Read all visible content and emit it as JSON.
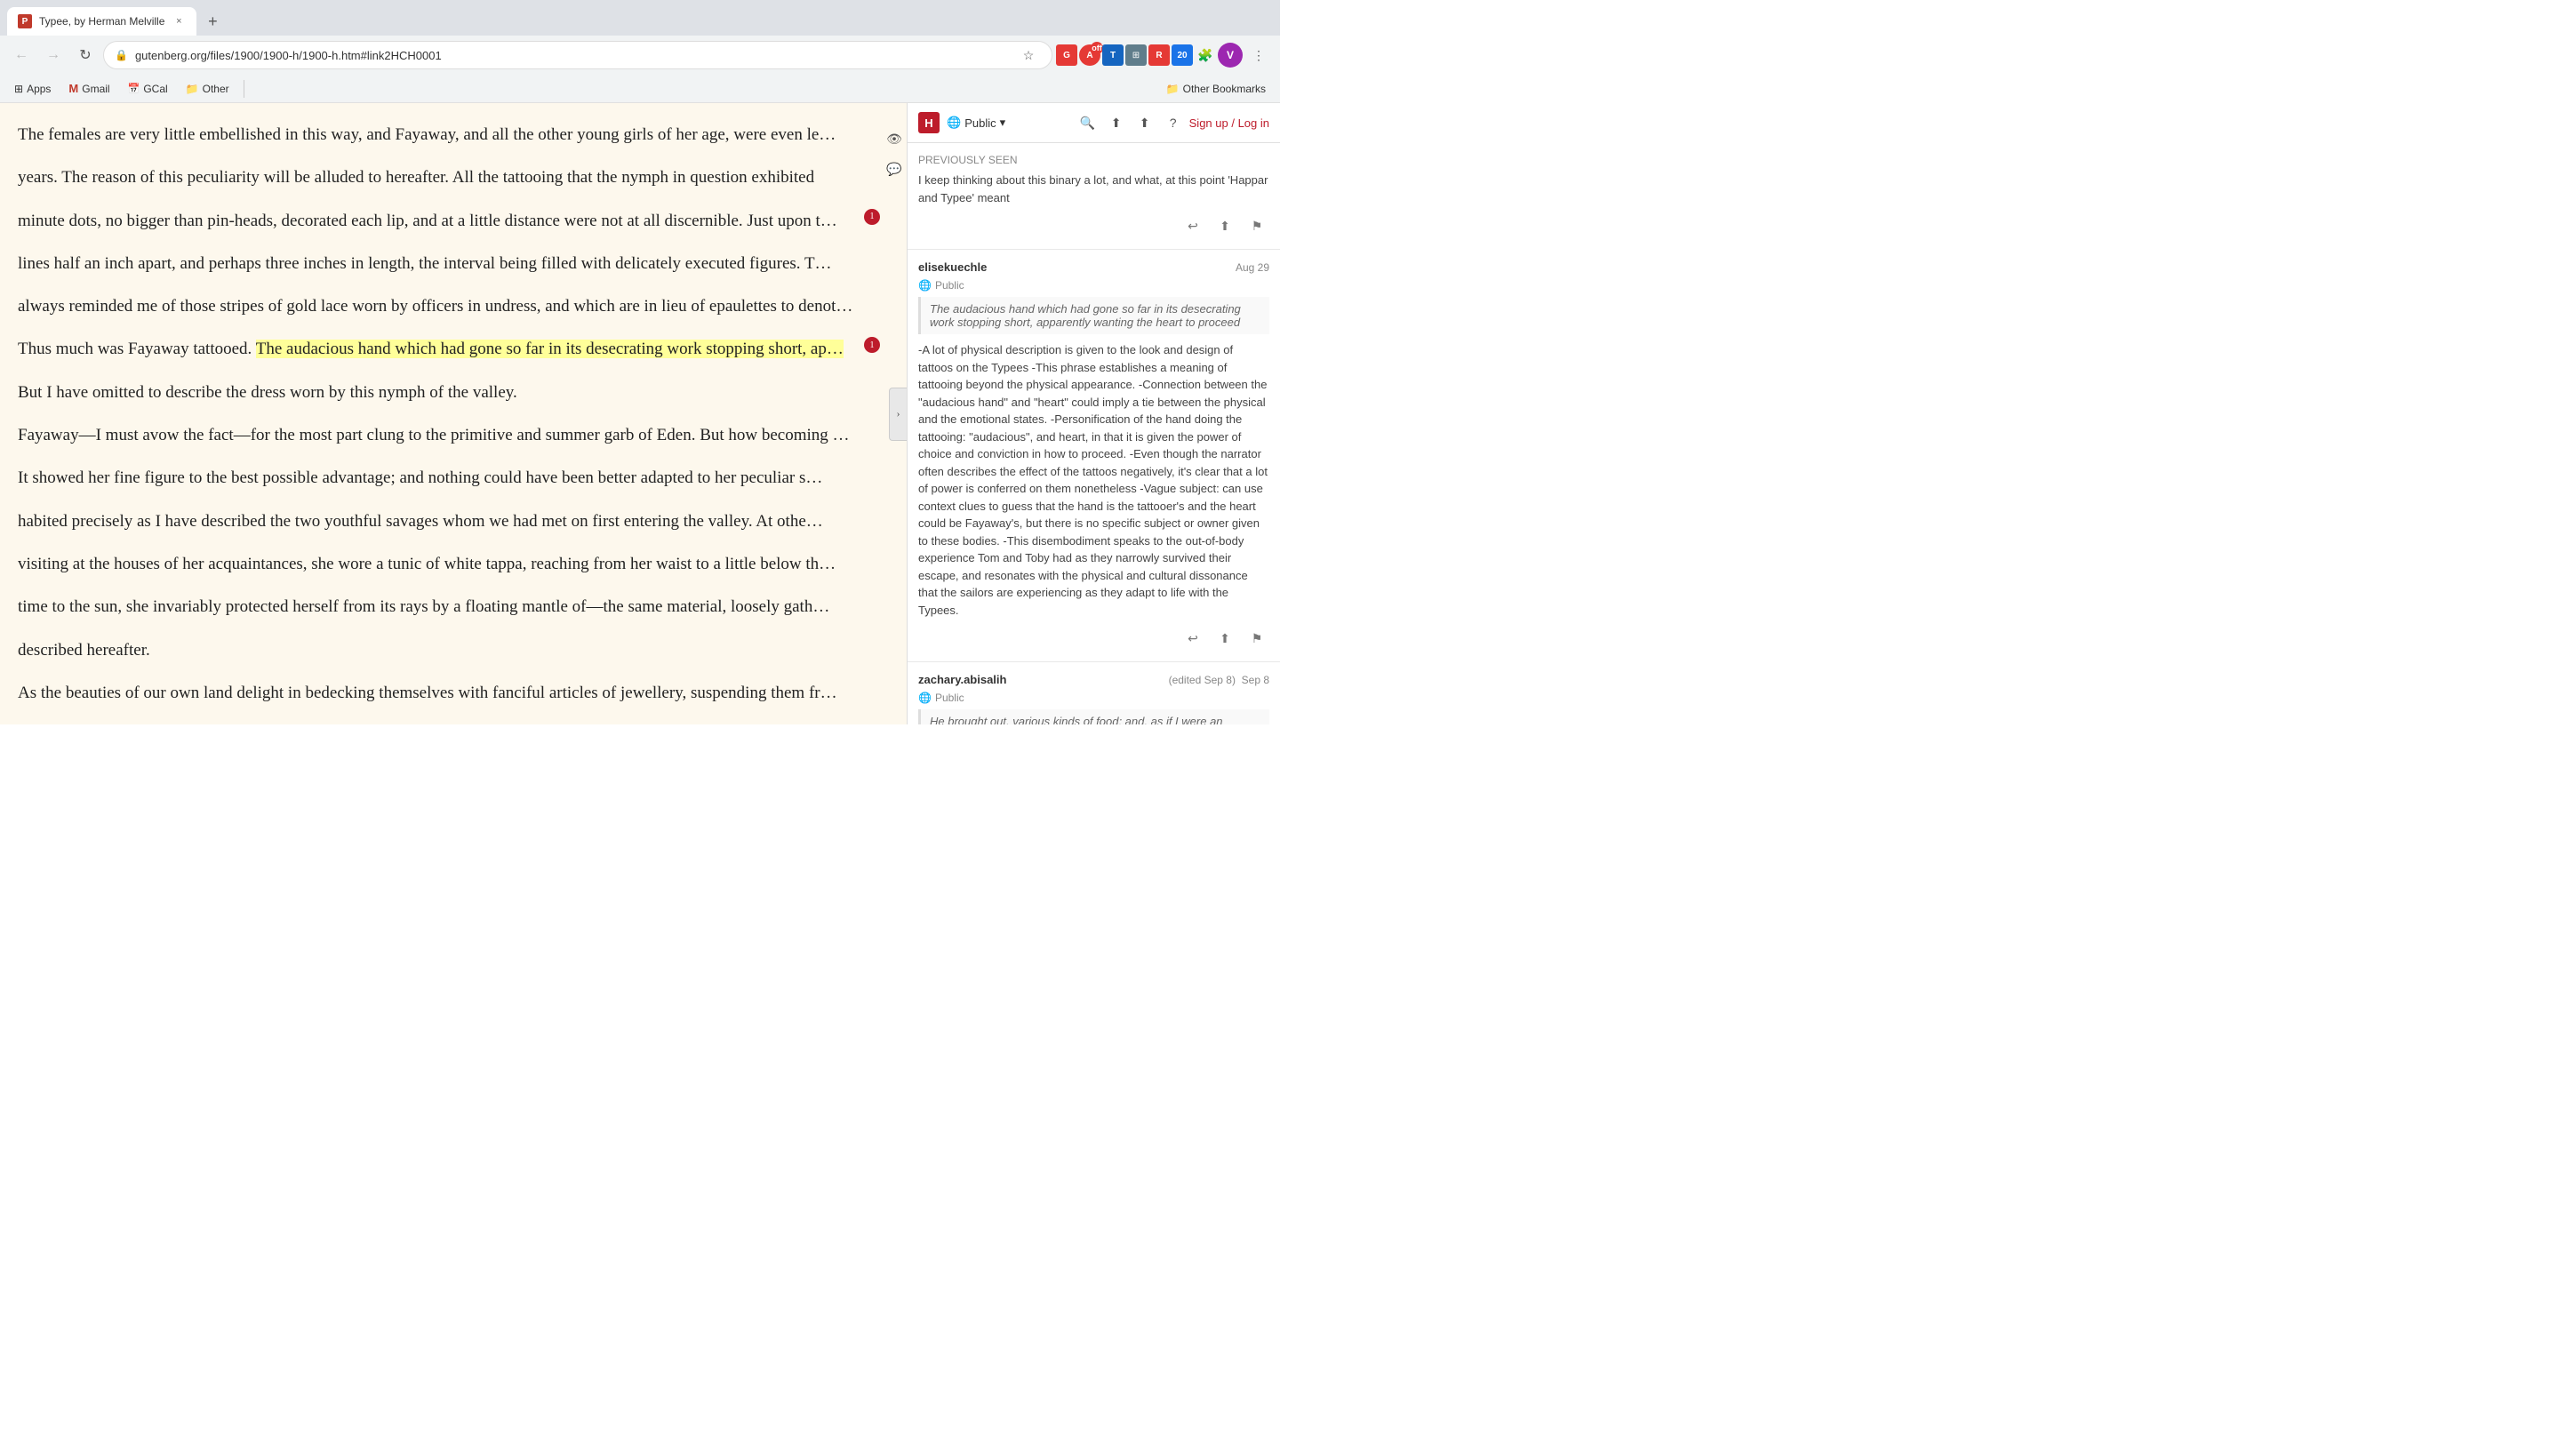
{
  "browser": {
    "tab": {
      "favicon": "P",
      "title": "Typee, by Herman Melville",
      "close": "×"
    },
    "new_tab_label": "+",
    "address": {
      "lock_icon": "🔒",
      "url": "gutenberg.org/files/1900/1900-h/1900-h.htm#link2HCH0001",
      "full_url": "https://gutenberg.org/files/1900/1900-h/1900-h.htm#link2HCH0001"
    },
    "nav": {
      "back": "←",
      "forward": "→",
      "refresh": "↻"
    },
    "actions": {
      "star": "☆",
      "extensions": "⚙",
      "menu": "⋮"
    }
  },
  "bookmarks": {
    "items": [
      {
        "icon": "🔲",
        "label": "Apps"
      },
      {
        "icon": "M",
        "label": "Gmail"
      },
      {
        "icon": "C",
        "label": "GCal"
      },
      {
        "icon": "📁",
        "label": "Other"
      }
    ],
    "other_bookmarks_label": "Other Bookmarks"
  },
  "reading_pane": {
    "paragraphs": [
      "The females are very little embellished in this way, and Fayaway, and all the other young girls of her age, were even le…",
      "years. The reason of this peculiarity will be alluded to hereafter. All the tattooing that the nymph in question exhibited",
      "minute dots, no bigger than pin-heads, decorated each lip, and at a little distance were not at all discernible. Just upon t…",
      "lines half an inch apart, and perhaps three inches in length, the interval being filled with delicately executed figures. T…",
      "always reminded me of those stripes of gold lace worn by officers in undress, and which are in lieu of epaulettes to denote…",
      "Thus much was Fayaway tattooed. The audacious hand which had gone so far in its desecrating work stopping short, ap…",
      "But I have omitted to describe the dress worn by this nymph of the valley.",
      "Fayaway—I must avow the fact—for the most part clung to the primitive and summer garb of Eden. But how becoming th…",
      "It showed her fine figure to the best possible advantage; and nothing could have been better adapted to her peculiar s…",
      "habited precisely as I have described the two youthful savages whom we had met on first entering the valley. At othe…",
      "visiting at the houses of her acquaintances, she wore a tunic of white tappa, reaching from her waist to a little below th…",
      "time to the sun, she invariably protected herself from its rays by a floating mantle of—the same material, loosely gath…",
      "described hereafter.",
      "As the beauties of our own land delight in bedecking themselves with fanciful articles of jewellery, suspending them fr…"
    ],
    "highlighted_text": "The audacious hand which had gone so far in its desecrating work stopping short, ap…",
    "inline_counts": [
      {
        "paragraph_index": 2,
        "count": 1
      },
      {
        "paragraph_index": 5,
        "count": 1
      }
    ]
  },
  "hypothesis": {
    "logo": "H",
    "visibility": "Public",
    "header_actions": {
      "search": "🔍",
      "share": "↑",
      "up_arrow": "⬆",
      "help": "?",
      "signup_text": "Sign up / Log in"
    },
    "annotations": [
      {
        "id": "ann1",
        "user": "",
        "date": "PREVIOUSLY SEEN",
        "visibility": "Public",
        "quote": "",
        "text": "I keep thinking about this binary a lot, and what, at this point 'Happar and Typee' meant",
        "has_quote": false
      },
      {
        "id": "ann2",
        "user": "elisekuechle",
        "date": "Aug 29",
        "visibility": "Public",
        "quote": "The audacious hand which had gone so far in its desecrating work stopping short, apparently wanting the heart to proceed",
        "text": "-A lot of physical description is given to the look and design of tattoos on the Typees -This phrase establishes a meaning of tattooing beyond the physical appearance. -Connection between the \"audacious hand\" and \"heart\" could imply a tie between the physical and the emotional states. -Personification of the hand doing the tattooing: \"audacious\", and heart, in that it is given the power of choice and conviction in how to proceed. -Even though the narrator often describes the effect of the tattoos negatively, it's clear that a lot of power is conferred on them nonetheless -Vague subject: can use context clues to guess that the hand is the tattooer's and the heart could be Fayaway's, but there is no specific subject or owner given to these bodies. -This disembodiment speaks to the out-of-body experience Tom and Toby had as they narrowly survived their escape, and resonates with the physical and cultural dissonance that the sailors are experiencing as they adapt to life with the Typees.",
        "has_quote": true
      },
      {
        "id": "ann3",
        "user": "zachary.abisalih",
        "date": "Sep 8",
        "date_edited": "(edited Sep 8)",
        "visibility": "Public",
        "quote": "He brought out, various kinds of food; and, as if I were an",
        "text": "He brought out, various kinds of food; and, as if I were an",
        "has_quote": true
      }
    ]
  },
  "icons": {
    "eye": "👁",
    "annotate": "💬",
    "count_badge": "1",
    "globe": "🌐",
    "reply": "↩",
    "share": "⬆",
    "flag": "⚑",
    "chevron_down": "▾",
    "chevron_right": "›"
  }
}
